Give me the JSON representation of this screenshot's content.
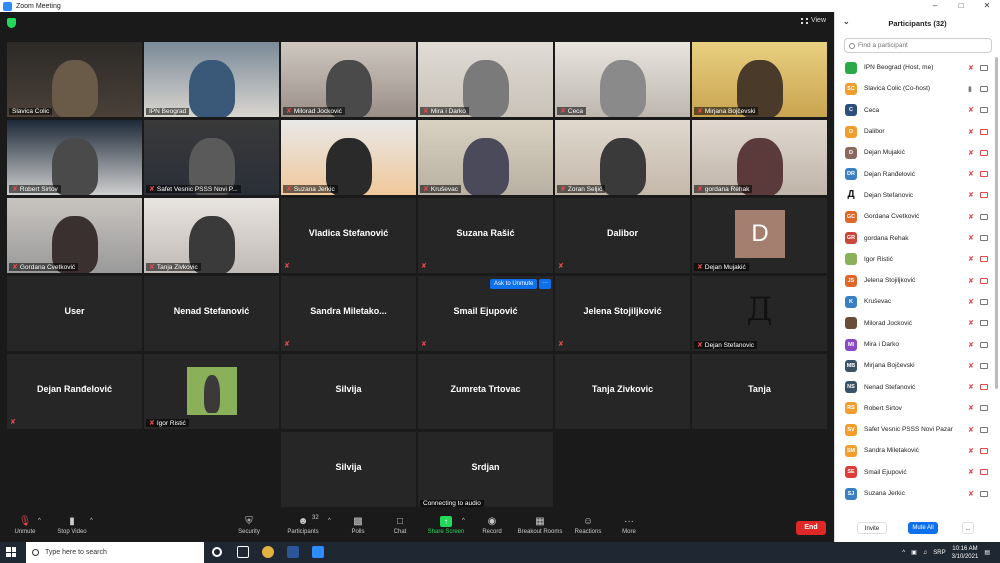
{
  "window": {
    "title": "Zoom Meeting",
    "controls": [
      "–",
      "□",
      "✕"
    ],
    "view_label": "View"
  },
  "tiles": [
    {
      "name": "Slavica Colic",
      "video": true,
      "muted": false,
      "active": true
    },
    {
      "name": "IPN Beograd",
      "video": true,
      "muted": false
    },
    {
      "name": "Milorad Jocković",
      "video": true,
      "muted": true
    },
    {
      "name": "Mira i Darko",
      "video": true,
      "muted": true
    },
    {
      "name": "Ceca",
      "video": true,
      "muted": true
    },
    {
      "name": "Mirjana Bojčevski",
      "video": true,
      "muted": true
    },
    {
      "name": "Robert Sirtov",
      "video": true,
      "muted": true
    },
    {
      "name": "Safet Vesnic PSSS Novi P...",
      "video": true,
      "muted": true
    },
    {
      "name": "Suzana Jerkic",
      "video": true,
      "muted": true
    },
    {
      "name": "Kruševac",
      "video": true,
      "muted": true
    },
    {
      "name": "Zoran Seljić",
      "video": true,
      "muted": true
    },
    {
      "name": "gordana Rehak",
      "video": true,
      "muted": true
    },
    {
      "name": "Gordana Cvetković",
      "video": true,
      "muted": true
    },
    {
      "name": "Tanja Zivkovic",
      "video": true,
      "muted": true
    },
    {
      "name": "Vladica Stefanović",
      "video": false,
      "muted": true
    },
    {
      "name": "Suzana Rašić",
      "video": false,
      "muted": true
    },
    {
      "name": "Dalibor",
      "video": false,
      "muted": true
    },
    {
      "name": "Dejan Mujakić",
      "video": false,
      "muted": true,
      "avatar": "D"
    },
    {
      "name": "User",
      "video": false,
      "muted": false
    },
    {
      "name": "Nenad Stefanović",
      "video": false,
      "muted": false
    },
    {
      "name": "Sandra  Miletako...",
      "video": false,
      "muted": true
    },
    {
      "name": "Smail Ejupović",
      "video": false,
      "muted": true,
      "ask_unmute": "Ask to Unmute"
    },
    {
      "name": "Jelena Stojiljković",
      "video": false,
      "muted": true
    },
    {
      "name": "Dejan Stefanovic",
      "video": false,
      "muted": true,
      "avatar": "Д"
    },
    {
      "name": "Dejan Ranđelović",
      "video": false,
      "muted": true
    },
    {
      "name": "Igor Ristić",
      "video": false,
      "muted": true,
      "photo": true
    },
    {
      "name": "Silvija",
      "video": false,
      "muted": false
    },
    {
      "name": "Zumreta Trtovac",
      "video": false,
      "muted": false
    },
    {
      "name": "Tanja Zivkovic",
      "video": false,
      "muted": false
    },
    {
      "name": "Tanja",
      "video": false,
      "muted": false
    },
    {
      "name": "Silvija",
      "video": false,
      "muted": false
    },
    {
      "name": "Srdjan",
      "video": false,
      "muted": false,
      "status": "Connecting to audio"
    }
  ],
  "toolbar": {
    "unmute": "Unmute",
    "stop_video": "Stop Video",
    "security": "Security",
    "participants": "Participants",
    "participants_count": "32",
    "polls": "Polls",
    "chat": "Chat",
    "share_screen": "Share Screen",
    "record": "Record",
    "breakout_rooms": "Breakout Rooms",
    "reactions": "Reactions",
    "more": "More",
    "end": "End"
  },
  "panel": {
    "title": "Participants (32)",
    "search_placeholder": "Find a participant",
    "invite": "Invite",
    "mute_all": "Mute All",
    "more": "...",
    "participants": [
      {
        "name": "IPN Beograd (Host, me)",
        "initials": "",
        "color": "#2aa84a",
        "mic_on": false,
        "cam_on": true
      },
      {
        "name": "Slavica Colic (Co-host)",
        "initials": "SC",
        "color": "#f29d2d",
        "mic_on": true,
        "cam_on": true
      },
      {
        "name": "Ceca",
        "initials": "C",
        "color": "#2c4f7c",
        "mic_on": false,
        "cam_on": true
      },
      {
        "name": "Dalibor",
        "initials": "D",
        "color": "#f29d2d",
        "mic_on": false,
        "cam_on": false
      },
      {
        "name": "Dejan Mujakić",
        "initials": "D",
        "color": "#8a6a5e",
        "mic_on": false,
        "cam_on": false
      },
      {
        "name": "Dejan Ranđelović",
        "initials": "DR",
        "color": "#3a7fc4",
        "mic_on": false,
        "cam_on": false
      },
      {
        "name": "Dejan Stefanovic",
        "initials": "Д",
        "color": "#ffffff",
        "mic_on": false,
        "cam_on": false
      },
      {
        "name": "Gordana Cvetković",
        "initials": "GC",
        "color": "#e0672a",
        "mic_on": false,
        "cam_on": true
      },
      {
        "name": "gordana Rehak",
        "initials": "GR",
        "color": "#c8473a",
        "mic_on": false,
        "cam_on": true
      },
      {
        "name": "Igor Ristić",
        "initials": "",
        "color": "#8bb05a",
        "mic_on": false,
        "cam_on": false
      },
      {
        "name": "Jelena Stojiljković",
        "initials": "JS",
        "color": "#e0672a",
        "mic_on": false,
        "cam_on": false
      },
      {
        "name": "Kruševac",
        "initials": "K",
        "color": "#3a7fc4",
        "mic_on": false,
        "cam_on": true
      },
      {
        "name": "Milorad Jocković",
        "initials": "",
        "color": "#6b4b3a",
        "mic_on": false,
        "cam_on": true
      },
      {
        "name": "Mira i Darko",
        "initials": "MI",
        "color": "#8a4ac4",
        "mic_on": false,
        "cam_on": true
      },
      {
        "name": "Mirjana Bojčevski",
        "initials": "MB",
        "color": "#3b5166",
        "mic_on": false,
        "cam_on": true
      },
      {
        "name": "Nenad Stefanović",
        "initials": "NS",
        "color": "#3b5166",
        "mic_on": false,
        "cam_on": false
      },
      {
        "name": "Robert Sirtov",
        "initials": "RS",
        "color": "#f29d2d",
        "mic_on": false,
        "cam_on": true
      },
      {
        "name": "Safet Vesnic PSSS Novi Pazar",
        "initials": "SV",
        "color": "#f29d2d",
        "mic_on": false,
        "cam_on": true
      },
      {
        "name": "Sandra Miletaković",
        "initials": "SM",
        "color": "#f29d2d",
        "mic_on": false,
        "cam_on": false
      },
      {
        "name": "Smail Ejupović",
        "initials": "SE",
        "color": "#e03a3a",
        "mic_on": false,
        "cam_on": false
      },
      {
        "name": "Suzana Jerkic",
        "initials": "SJ",
        "color": "#3a7fc4",
        "mic_on": false,
        "cam_on": true
      }
    ]
  },
  "taskbar": {
    "search_placeholder": "Type here to search",
    "language": "SRP",
    "time": "10:16 AM",
    "date": "3/10/2021"
  }
}
